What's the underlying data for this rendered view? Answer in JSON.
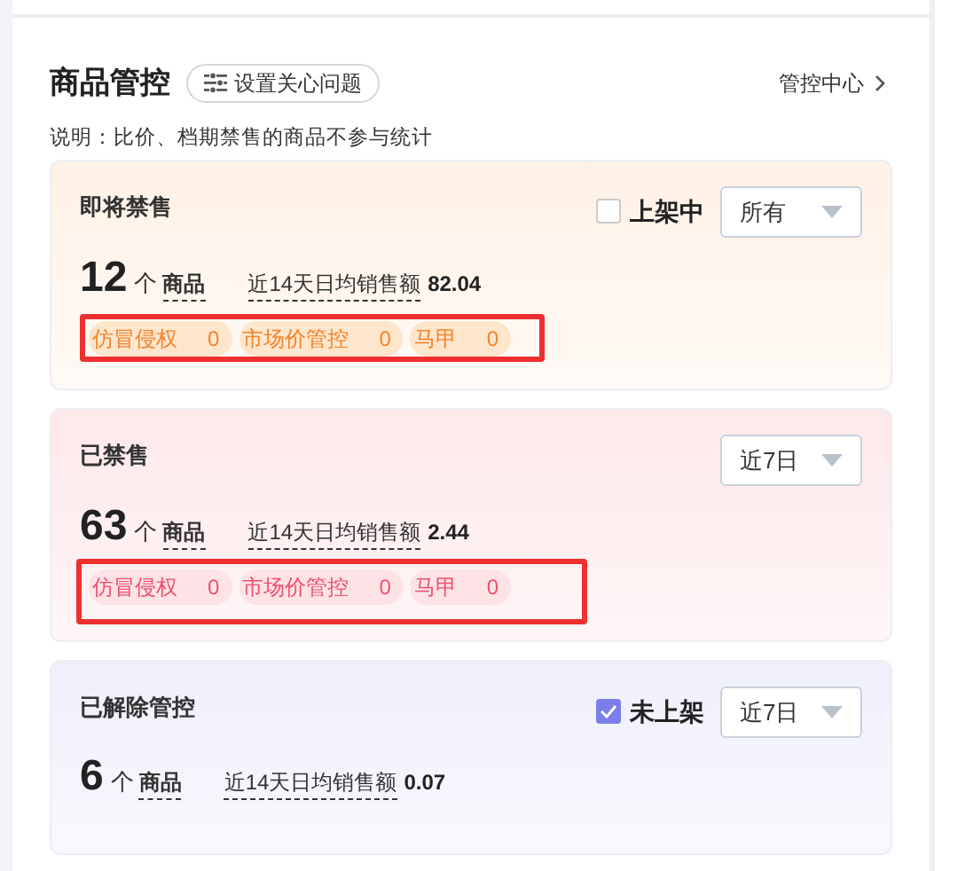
{
  "header": {
    "title": "商品管控",
    "settings_button": "设置关心问题",
    "link": "管控中心"
  },
  "note": "说明：比价、档期禁售的商品不参与统计",
  "cards": [
    {
      "kind": "upcoming",
      "title": "即将禁售",
      "checkbox": {
        "label": "上架中",
        "checked": false
      },
      "dropdown": "所有",
      "count": "12",
      "unit": "个",
      "count_label": "商品",
      "metric_label": "近14天日均销售额",
      "metric_value": "82.04",
      "tags_highlighted": true,
      "tags": [
        {
          "label": "仿冒侵权",
          "value": "0"
        },
        {
          "label": "市场价管控",
          "value": "0"
        },
        {
          "label": "马甲",
          "value": "0"
        }
      ]
    },
    {
      "kind": "banned",
      "title": "已禁售",
      "dropdown": "近7日",
      "count": "63",
      "unit": "个",
      "count_label": "商品",
      "metric_label": "近14天日均销售额",
      "metric_value": "2.44",
      "tags_highlighted": true,
      "tags": [
        {
          "label": "仿冒侵权",
          "value": "0"
        },
        {
          "label": "市场价管控",
          "value": "0"
        },
        {
          "label": "马甲",
          "value": "0"
        }
      ]
    },
    {
      "kind": "released",
      "title": "已解除管控",
      "checkbox": {
        "label": "未上架",
        "checked": true
      },
      "dropdown": "近7日",
      "count": "6",
      "unit": "个",
      "count_label": "商品",
      "metric_label": "近14天日均销售额",
      "metric_value": "0.07"
    }
  ]
}
